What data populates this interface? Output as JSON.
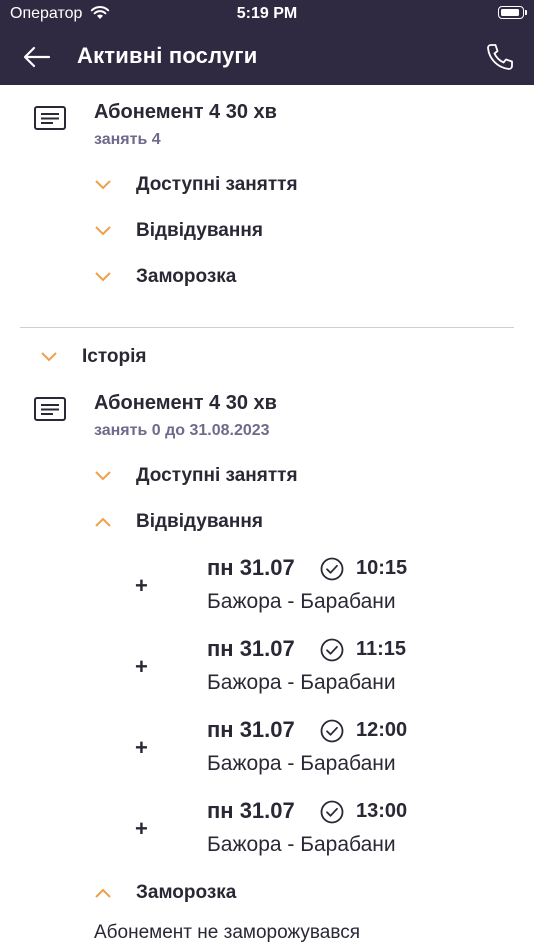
{
  "status_bar": {
    "carrier": "Оператор",
    "time": "5:19 PM"
  },
  "nav": {
    "title": "Активні послуги",
    "back_icon": "arrow-left-icon",
    "phone_icon": "phone-icon"
  },
  "active_subscription": {
    "title": "Абонемент 4 30 хв",
    "info": "занять 4",
    "sections": [
      "Доступні заняття",
      "Відвідування",
      "Заморозка"
    ]
  },
  "history": {
    "label": "Історія",
    "subscription": {
      "title": "Абонемент 4 30 хв",
      "info": "занять 0 до 31.08.2023",
      "available_label": "Доступні заняття",
      "visits_label": "Відвідування",
      "visits": [
        {
          "plus": "+",
          "day": "пн 31.07",
          "time": "10:15",
          "name": "Бажора - Барабани"
        },
        {
          "plus": "+",
          "day": "пн 31.07",
          "time": "11:15",
          "name": "Бажора - Барабани"
        },
        {
          "plus": "+",
          "day": "пн 31.07",
          "time": "12:00",
          "name": "Бажора - Барабани"
        },
        {
          "plus": "+",
          "day": "пн 31.07",
          "time": "13:00",
          "name": "Бажора - Барабани"
        }
      ],
      "freeze_label": "Заморозка",
      "freeze_note": "Абонемент не заморожувався"
    }
  },
  "colors": {
    "header": "#2f2a41",
    "accent": "#f0a04b",
    "muted": "#6e6a8c",
    "text": "#2b2835"
  }
}
